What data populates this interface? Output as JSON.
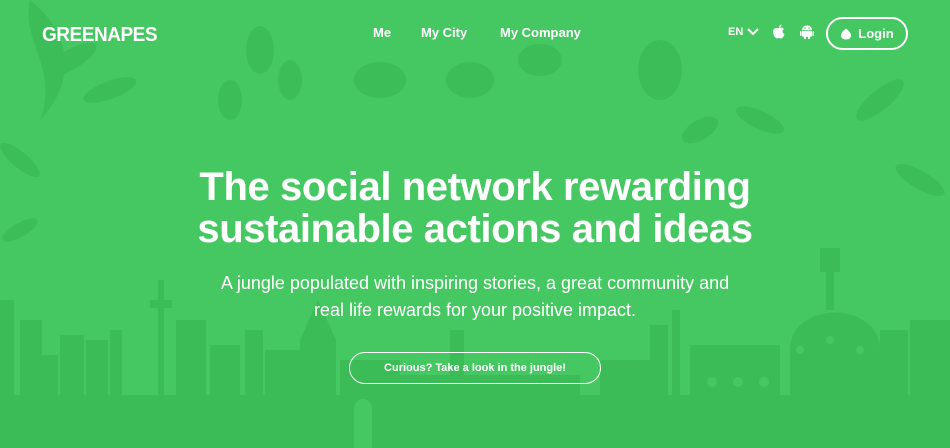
{
  "brand": {
    "logo_text": "GREENAPES"
  },
  "nav": {
    "items": [
      {
        "label": "Me"
      },
      {
        "label": "My City"
      },
      {
        "label": "My Company"
      }
    ],
    "language": "EN",
    "login_label": "Login"
  },
  "hero": {
    "title_line1": "The social network rewarding",
    "title_line2": "sustainable actions and ideas",
    "subtitle_line1": "A jungle populated with inspiring stories, a great community and",
    "subtitle_line2": "real life rewards for your positive impact.",
    "cta_label": "Curious? Take a look in the jungle!"
  },
  "colors": {
    "background": "#45c862",
    "skyline": "#3bbc57",
    "foliage": "#3cbd58",
    "text": "#ffffff"
  },
  "icons": [
    "chevron-down-icon",
    "apple-icon",
    "android-icon",
    "leaf-icon"
  ]
}
